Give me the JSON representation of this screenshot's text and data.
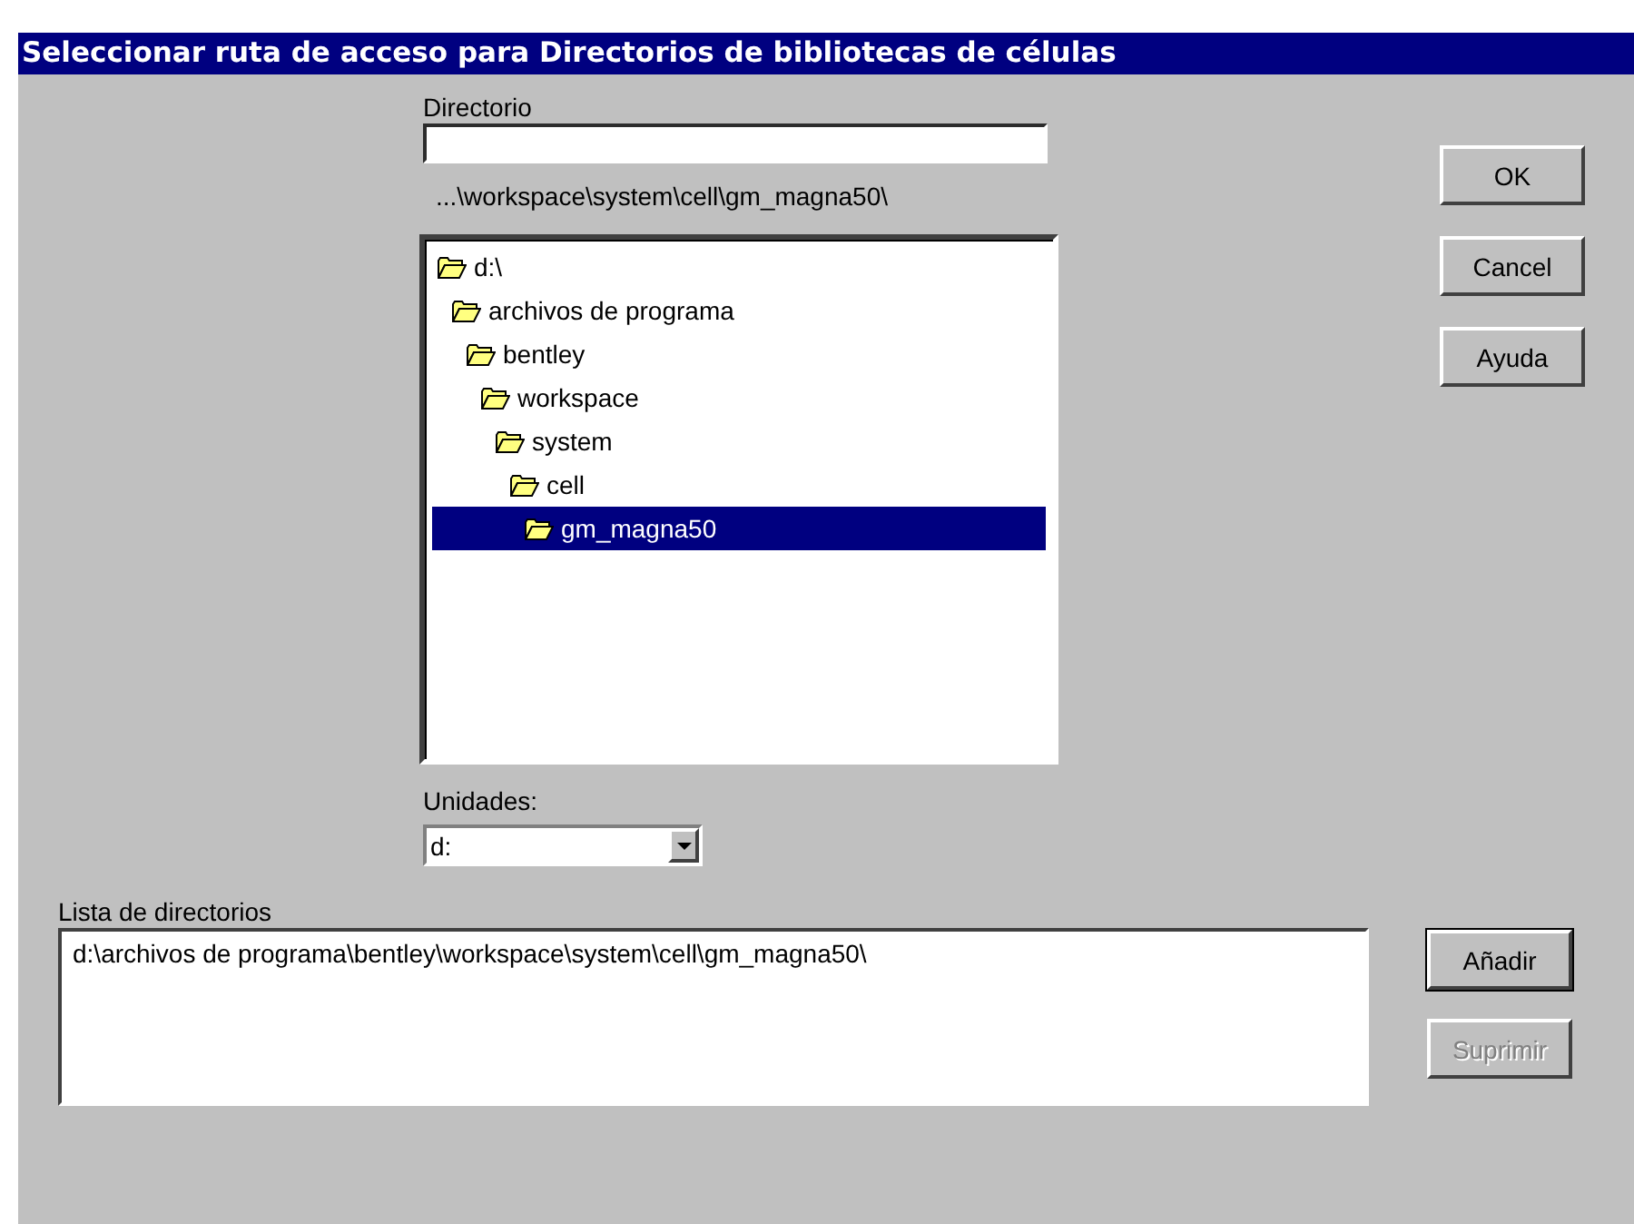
{
  "window": {
    "title": "Seleccionar ruta de acceso para Directorios de bibliotecas de células"
  },
  "directory_field": {
    "label": "Directorio"
  },
  "current_path": "...\\workspace\\system\\cell\\gm_magna50\\",
  "folder_tree": [
    {
      "label": "d:\\",
      "selected": false,
      "children": [
        {
          "label": "archivos de programa",
          "selected": false,
          "children": [
            {
              "label": "bentley",
              "selected": false,
              "children": [
                {
                  "label": "workspace",
                  "selected": false,
                  "children": [
                    {
                      "label": "system",
                      "selected": false,
                      "children": [
                        {
                          "label": "cell",
                          "selected": false,
                          "children": [
                            {
                              "label": "gm_magna50",
                              "selected": true
                            }
                          ]
                        }
                      ]
                    }
                  ]
                }
              ]
            }
          ]
        }
      ]
    }
  ],
  "drives": {
    "label": "Unidades:",
    "value": "d:"
  },
  "dialog_buttons": [
    {
      "label": "OK",
      "default": false,
      "disabled": false
    },
    {
      "label": "Cancel",
      "default": false,
      "disabled": false
    },
    {
      "label": "Ayuda",
      "default": false,
      "disabled": false
    }
  ],
  "directory_list": {
    "label": "Lista de directorios",
    "items": [
      "d:\\archivos de programa\\bentley\\workspace\\system\\cell\\gm_magna50\\"
    ]
  },
  "list_buttons": [
    {
      "label": "Añadir",
      "default": true,
      "disabled": false
    },
    {
      "label": "Suprimir",
      "default": false,
      "disabled": true
    }
  ]
}
